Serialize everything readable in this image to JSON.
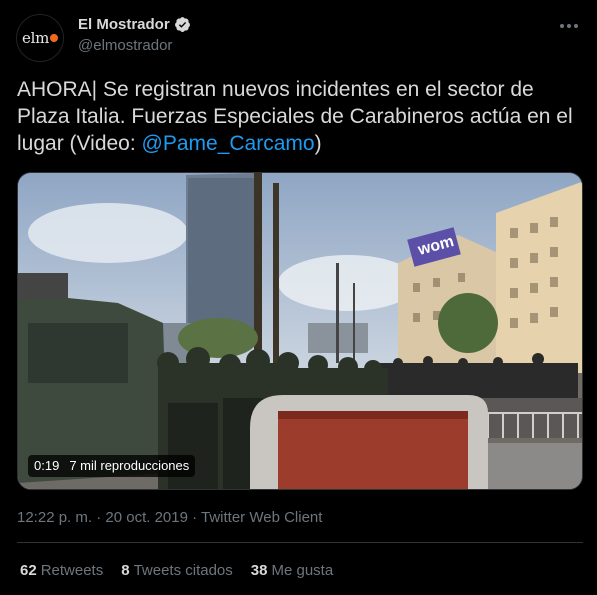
{
  "account": {
    "avatar_text": "elm",
    "display_name": "El Mostrador",
    "handle": "@elmostrador",
    "verified": true
  },
  "tweet": {
    "text": "AHORA| Se registran nuevos incidentes en el sector de Plaza Italia. Fuerzas Especiales de Carabineros actúa en el lugar (Video: ",
    "mention": "@Pame_Carcamo",
    "text_end": ")"
  },
  "video": {
    "duration": "0:19",
    "views": "7 mil reproducciones",
    "billboard_text": "wom"
  },
  "meta": {
    "timestamp": "12:22 p. m. · 20 oct. 2019 · Twitter Web Client"
  },
  "stats": {
    "retweets_count": "62",
    "retweets_label": "Retweets",
    "quotes_count": "8",
    "quotes_label": "Tweets citados",
    "likes_count": "38",
    "likes_label": "Me gusta"
  },
  "icons": {
    "verified": "verified-badge-icon",
    "more": "more-options-icon"
  },
  "colors": {
    "background": "#000000",
    "link": "#1d9bf0",
    "secondary_text": "#6e767d",
    "avatar_accent": "#f26a1b"
  }
}
